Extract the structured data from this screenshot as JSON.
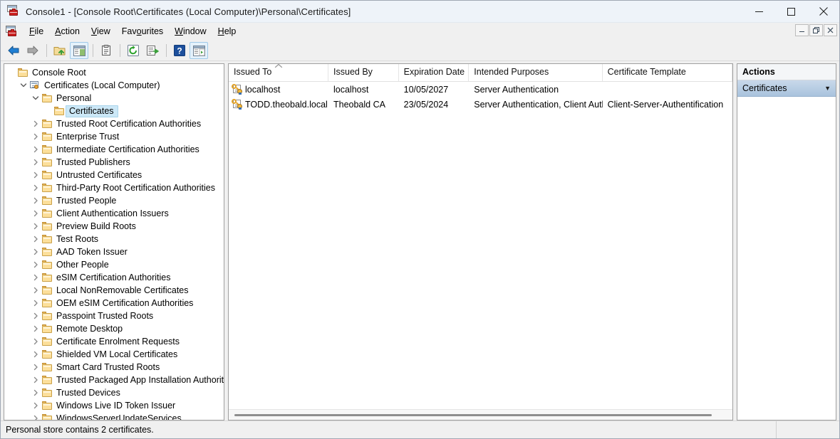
{
  "window": {
    "title": "Console1 - [Console Root\\Certificates (Local Computer)\\Personal\\Certificates]",
    "icon": "mmc-console-icon",
    "minimize_label": "Minimise",
    "maximize_label": "Maximise",
    "close_label": "Close",
    "mdi_minimize_label": "Minimise child window",
    "mdi_restore_label": "Restore child window",
    "mdi_close_label": "Close child window"
  },
  "menubar": {
    "icon": "mmc-console-icon",
    "items": [
      {
        "label": "File",
        "mnemonic": "F"
      },
      {
        "label": "Action",
        "mnemonic": "A"
      },
      {
        "label": "View",
        "mnemonic": "V"
      },
      {
        "label": "Favourites",
        "mnemonic": "o"
      },
      {
        "label": "Window",
        "mnemonic": "W"
      },
      {
        "label": "Help",
        "mnemonic": "H"
      }
    ]
  },
  "toolbar": {
    "buttons": [
      {
        "name": "back-icon",
        "title": "Back"
      },
      {
        "name": "forward-icon",
        "title": "Forward"
      },
      {
        "name": "separator",
        "title": ""
      },
      {
        "name": "up-one-level-icon",
        "title": "Up one level"
      },
      {
        "name": "show-hide-console-tree-icon",
        "title": "Show/Hide Console Tree"
      },
      {
        "name": "separator",
        "title": ""
      },
      {
        "name": "properties-icon",
        "title": "Properties"
      },
      {
        "name": "separator",
        "title": ""
      },
      {
        "name": "refresh-icon",
        "title": "Refresh"
      },
      {
        "name": "export-list-icon",
        "title": "Export List"
      },
      {
        "name": "separator",
        "title": ""
      },
      {
        "name": "help-icon",
        "title": "Help"
      },
      {
        "name": "show-hide-action-pane-icon",
        "title": "Show/Hide Action Pane"
      }
    ]
  },
  "tree": {
    "items": [
      {
        "label": "Console Root",
        "depth": 0,
        "expander": "none",
        "icon": "folder-icon",
        "selected": false
      },
      {
        "label": "Certificates (Local Computer)",
        "depth": 1,
        "expander": "expanded",
        "icon": "certificate-store-icon",
        "selected": false
      },
      {
        "label": "Personal",
        "depth": 2,
        "expander": "expanded",
        "icon": "folder-icon",
        "selected": false
      },
      {
        "label": "Certificates",
        "depth": 3,
        "expander": "none",
        "icon": "folder-icon",
        "selected": true
      },
      {
        "label": "Trusted Root Certification Authorities",
        "depth": 2,
        "expander": "collapsed",
        "icon": "folder-icon",
        "selected": false
      },
      {
        "label": "Enterprise Trust",
        "depth": 2,
        "expander": "collapsed",
        "icon": "folder-icon",
        "selected": false
      },
      {
        "label": "Intermediate Certification Authorities",
        "depth": 2,
        "expander": "collapsed",
        "icon": "folder-icon",
        "selected": false
      },
      {
        "label": "Trusted Publishers",
        "depth": 2,
        "expander": "collapsed",
        "icon": "folder-icon",
        "selected": false
      },
      {
        "label": "Untrusted Certificates",
        "depth": 2,
        "expander": "collapsed",
        "icon": "folder-icon",
        "selected": false
      },
      {
        "label": "Third-Party Root Certification Authorities",
        "depth": 2,
        "expander": "collapsed",
        "icon": "folder-icon",
        "selected": false
      },
      {
        "label": "Trusted People",
        "depth": 2,
        "expander": "collapsed",
        "icon": "folder-icon",
        "selected": false
      },
      {
        "label": "Client Authentication Issuers",
        "depth": 2,
        "expander": "collapsed",
        "icon": "folder-icon",
        "selected": false
      },
      {
        "label": "Preview Build Roots",
        "depth": 2,
        "expander": "collapsed",
        "icon": "folder-icon",
        "selected": false
      },
      {
        "label": "Test Roots",
        "depth": 2,
        "expander": "collapsed",
        "icon": "folder-icon",
        "selected": false
      },
      {
        "label": "AAD Token Issuer",
        "depth": 2,
        "expander": "collapsed",
        "icon": "folder-icon",
        "selected": false
      },
      {
        "label": "Other People",
        "depth": 2,
        "expander": "collapsed",
        "icon": "folder-icon",
        "selected": false
      },
      {
        "label": "eSIM Certification Authorities",
        "depth": 2,
        "expander": "collapsed",
        "icon": "folder-icon",
        "selected": false
      },
      {
        "label": "Local NonRemovable Certificates",
        "depth": 2,
        "expander": "collapsed",
        "icon": "folder-icon",
        "selected": false
      },
      {
        "label": "OEM eSIM Certification Authorities",
        "depth": 2,
        "expander": "collapsed",
        "icon": "folder-icon",
        "selected": false
      },
      {
        "label": "Passpoint Trusted Roots",
        "depth": 2,
        "expander": "collapsed",
        "icon": "folder-icon",
        "selected": false
      },
      {
        "label": "Remote Desktop",
        "depth": 2,
        "expander": "collapsed",
        "icon": "folder-icon",
        "selected": false
      },
      {
        "label": "Certificate Enrolment Requests",
        "depth": 2,
        "expander": "collapsed",
        "icon": "folder-icon",
        "selected": false
      },
      {
        "label": "Shielded VM Local Certificates",
        "depth": 2,
        "expander": "collapsed",
        "icon": "folder-icon",
        "selected": false
      },
      {
        "label": "Smart Card Trusted Roots",
        "depth": 2,
        "expander": "collapsed",
        "icon": "folder-icon",
        "selected": false
      },
      {
        "label": "Trusted Packaged App Installation Authorities",
        "depth": 2,
        "expander": "collapsed",
        "icon": "folder-icon",
        "selected": false
      },
      {
        "label": "Trusted Devices",
        "depth": 2,
        "expander": "collapsed",
        "icon": "folder-icon",
        "selected": false
      },
      {
        "label": "Windows Live ID Token Issuer",
        "depth": 2,
        "expander": "collapsed",
        "icon": "folder-icon",
        "selected": false
      },
      {
        "label": "WindowsServerUpdateServices",
        "depth": 2,
        "expander": "collapsed",
        "icon": "folder-icon",
        "selected": false
      }
    ]
  },
  "list": {
    "sort_column": "Issued To",
    "sort_direction": "ascending",
    "columns": [
      {
        "label": "Issued To",
        "width": 142,
        "sorted": true
      },
      {
        "label": "Issued By",
        "width": 100,
        "sorted": false
      },
      {
        "label": "Expiration Date",
        "width": 100,
        "sorted": false
      },
      {
        "label": "Intended Purposes",
        "width": 190,
        "sorted": false
      },
      {
        "label": "Certificate Template",
        "width": 185,
        "sorted": false
      }
    ],
    "rows": [
      {
        "issued_to": "localhost",
        "issued_by": "localhost",
        "expiration_date": "10/05/2027",
        "intended_purposes": "Server Authentication",
        "certificate_template": "",
        "icon": "certificate-icon"
      },
      {
        "issued_to": "TODD.theobald.local",
        "issued_by": "Theobald CA",
        "expiration_date": "23/05/2024",
        "intended_purposes": "Server Authentication, Client Auth",
        "certificate_template": "Client-Server-Authentification",
        "icon": "certificate-icon"
      }
    ]
  },
  "actions": {
    "header": "Actions",
    "items": [
      {
        "label": "Certificates",
        "expander": "chevron-down-icon"
      }
    ]
  },
  "statusbar": {
    "message": "Personal store contains 2 certificates."
  }
}
